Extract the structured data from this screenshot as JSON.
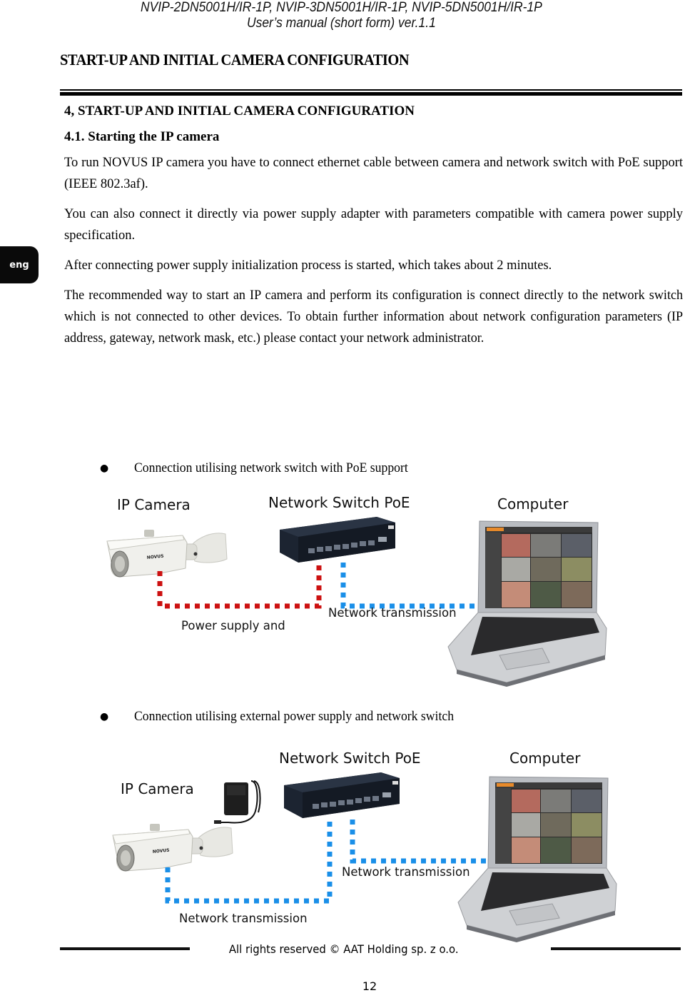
{
  "header": {
    "models": "NVIP-2DN5001H/IR-1P, NVIP-3DN5001H/IR-1P, NVIP-5DN5001H/IR-1P",
    "manual": "User’s manual (short form) ver.1.1"
  },
  "chapter_title": "START-UP AND INITIAL CAMERA CONFIGURATION",
  "language_tab": "eng",
  "section": {
    "heading": "4, START-UP AND INITIAL CAMERA CONFIGURATION",
    "subheading": "4.1. Starting the IP camera",
    "paragraphs": [
      "To run NOVUS IP camera you have to connect ethernet cable between camera and network switch with PoE support  (IEEE 802.3af).",
      "You can also connect it directly via power supply adapter with parameters compatible with camera power supply specification.",
      "After connecting power supply initialization process is started, which takes about 2 minutes.",
      "The recommended way to start an IP camera and perform its configuration is connect directly to the network switch which is not connected to other devices. To obtain further information about network configuration parameters (IP address, gateway, network mask, etc.) please  contact your network administrator."
    ]
  },
  "diagrams": [
    {
      "bullet": "Connection utilising network switch with PoE support",
      "labels": {
        "camera": "IP Camera",
        "switch": "Network Switch PoE",
        "computer": "Computer",
        "link_camera_switch": "Power supply and",
        "link_switch_computer": "Network transmission"
      },
      "link_colors": {
        "power_and_data": "#cc1111",
        "data": "#1a8fe8"
      }
    },
    {
      "bullet": "Connection utilising external power supply and network switch",
      "labels": {
        "camera": "IP Camera",
        "switch": "Network Switch PoE",
        "computer": "Computer",
        "link_camera_switch": "Network transmission",
        "link_switch_computer": "Network transmission"
      },
      "link_colors": {
        "data": "#1a8fe8"
      }
    }
  ],
  "footer": {
    "copyright": "All rights reserved © AAT Holding sp. z o.o.",
    "page_number": "12"
  }
}
